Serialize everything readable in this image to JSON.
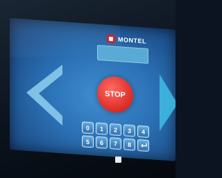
{
  "brand": {
    "name": "MONTEL",
    "icon": "brand-logo-icon"
  },
  "status_panel": {
    "line1": "",
    "line2": ""
  },
  "controls": {
    "stop_label": "STOP",
    "left_arrow_icon": "arrow-left-icon",
    "right_arrow_icon": "arrow-right-icon"
  },
  "keypad": {
    "keys": [
      {
        "label": "0",
        "icon": ""
      },
      {
        "label": "1",
        "icon": ""
      },
      {
        "label": "2",
        "icon": ""
      },
      {
        "label": "3",
        "icon": ""
      },
      {
        "label": "4",
        "icon": ""
      },
      {
        "label": "5",
        "icon": ""
      },
      {
        "label": "6",
        "icon": ""
      },
      {
        "label": "7",
        "icon": ""
      },
      {
        "label": "8",
        "icon": ""
      },
      {
        "label": "",
        "icon": "enter-icon"
      }
    ]
  },
  "colors": {
    "screen": "#2a6fb3",
    "stop": "#e0332c",
    "arrow": "#8fd0f0",
    "brand": "#d5202c"
  }
}
